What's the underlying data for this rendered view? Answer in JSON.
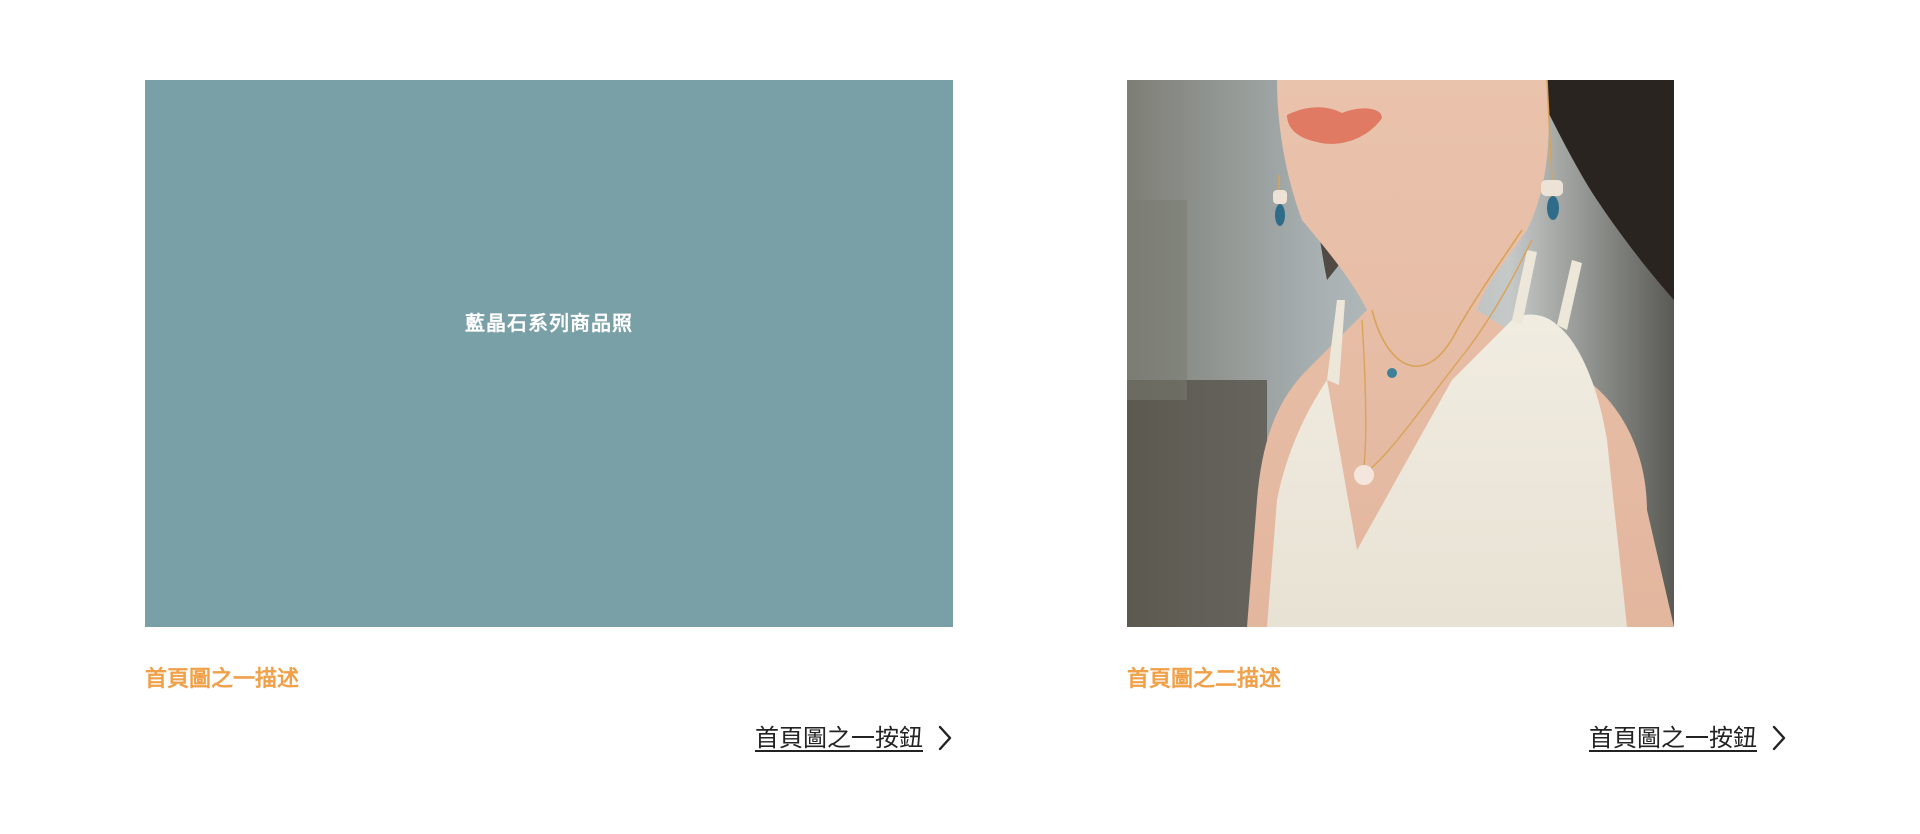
{
  "cards": [
    {
      "overlay_text": "藍晶石系列商品照",
      "description": "首頁圖之一描述",
      "button_label": "首頁圖之一按鈕",
      "icon": "chevron-right-icon",
      "placeholder_color": "#7aa0a7"
    },
    {
      "image_alt": "",
      "description": "首頁圖之二描述",
      "button_label": "首頁圖之一按鈕",
      "icon": "chevron-right-icon"
    }
  ],
  "colors": {
    "accent": "#f0a048",
    "text": "#222222",
    "background": "#ffffff"
  }
}
